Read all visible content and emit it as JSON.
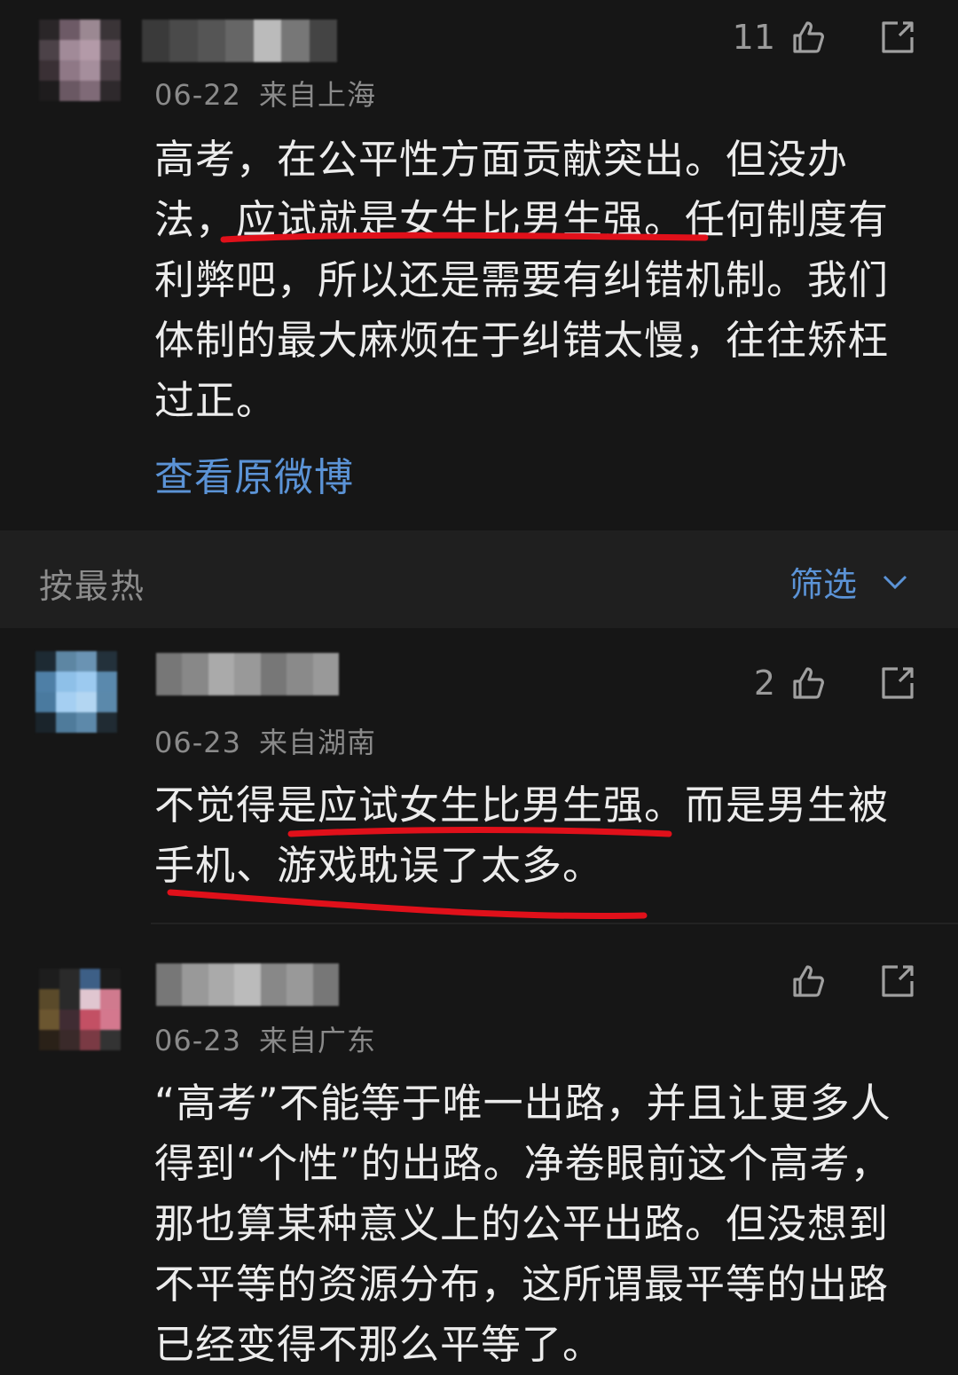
{
  "comments": [
    {
      "date": "06-22",
      "location": "来自上海",
      "likes": "11",
      "text": "高考，在公平性方面贡献突出。但没办法，应试就是女生比男生强。任何制度有利弊吧，所以还是需要有纠错机制。我们体制的最大麻烦在于纠错太慢，往往矫枉过正。",
      "link": "查看原微博"
    },
    {
      "date": "06-23",
      "location": "来自湖南",
      "likes": "2",
      "text": "不觉得是应试女生比男生强。而是男生被手机、游戏耽误了太多。"
    },
    {
      "date": "06-23",
      "location": "来自广东",
      "likes": "",
      "text": "“高考”不能等于唯一出路，并且让更多人得到“个性”的出路。净卷眼前这个高考，那也算某种意义上的公平出路。但没想到不平等的资源分布，这所谓最平等的出路已经变得不那么平等了。"
    }
  ],
  "sort": {
    "label": "按最热",
    "filter_label": "筛选"
  },
  "icons": {
    "like": "thumbs-up-icon",
    "share": "share-icon",
    "filter": "chevron-down-icon"
  },
  "colors": {
    "background": "#161616",
    "link": "#5b93d6",
    "annotation": "#e0101a"
  }
}
